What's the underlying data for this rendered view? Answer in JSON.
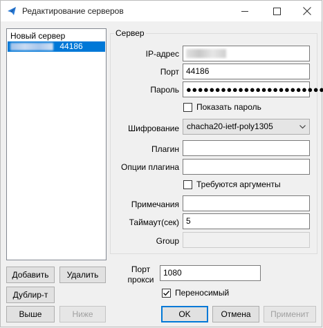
{
  "window": {
    "title": "Редактирование серверов",
    "accent": "#0078d7"
  },
  "server_list": {
    "items": [
      {
        "label": "Новый сервер",
        "selected": false
      },
      {
        "label": "44186",
        "selected": true
      }
    ]
  },
  "list_buttons": {
    "add": "Добавить",
    "delete": "Удалить",
    "duplicate": "Дублир-т",
    "up": "Выше",
    "down": "Ниже"
  },
  "server_group": {
    "title": "Сервер",
    "ip_label": "IP-адрес",
    "port_label": "Порт",
    "port_value": "44186",
    "password_label": "Пароль",
    "password_value": "●●●●●●●●●●●●●●●●●●●●●●●●",
    "show_password_label": "Показать пароль",
    "show_password_checked": false,
    "encryption_label": "Шифрование",
    "encryption_value": "chacha20-ietf-poly1305",
    "plugin_label": "Плагин",
    "plugin_value": "",
    "plugin_options_label": "Опции плагина",
    "plugin_options_value": "",
    "args_required_label": "Требуются аргументы",
    "args_required_checked": false,
    "notes_label": "Примечания",
    "notes_value": "",
    "timeout_label": "Таймаут(сек)",
    "timeout_value": "5",
    "group_label": "Group",
    "group_value": ""
  },
  "proxy": {
    "port_label_line1": "Порт",
    "port_label_line2": "прокси",
    "port_value": "1080"
  },
  "portable": {
    "label": "Переносимый",
    "checked": true
  },
  "dialog_buttons": {
    "ok": "OK",
    "cancel": "Отмена",
    "apply": "Применит"
  }
}
